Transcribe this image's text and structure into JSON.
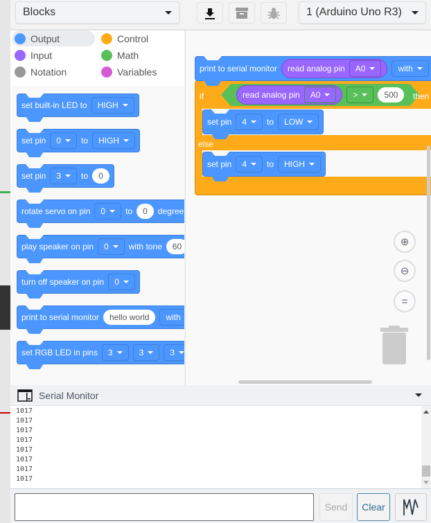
{
  "header": {
    "editor_mode": "Blocks",
    "device": "1 (Arduino Uno R3)",
    "toolbar": [
      {
        "icon": "download-icon"
      },
      {
        "icon": "library-icon"
      },
      {
        "icon": "debug-bug-icon"
      }
    ]
  },
  "categories": [
    {
      "label": "Output",
      "color": "#4c97ff",
      "selected": true
    },
    {
      "label": "Control",
      "color": "#ffab19"
    },
    {
      "label": "Input",
      "color": "#9966ff"
    },
    {
      "label": "Math",
      "color": "#59c059"
    },
    {
      "label": "Notation",
      "color": "#999999"
    },
    {
      "label": "Variables",
      "color": "#d65cd6"
    }
  ],
  "palette": {
    "b1": {
      "text": "set built-in LED to",
      "v": "HIGH"
    },
    "b2": {
      "text": "set pin",
      "pin": "0",
      "to": "to",
      "v": "HIGH"
    },
    "b3": {
      "text": "set pin",
      "pin": "3",
      "to": "to",
      "v": "0"
    },
    "b4": {
      "text": "rotate servo on pin",
      "pin": "0",
      "to": "to",
      "v": "0",
      "tail": "degrees"
    },
    "b5": {
      "text": "play speaker on pin",
      "pin": "0",
      "mid": "with tone",
      "v": "60"
    },
    "b6": {
      "text": "turn off speaker on pin",
      "pin": "0"
    },
    "b7": {
      "text": "print to serial monitor",
      "v": "hello world",
      "mid": "with"
    },
    "b8": {
      "text": "set RGB LED in pins",
      "p1": "3",
      "p2": "3",
      "p3": "3"
    }
  },
  "workspace": {
    "print": {
      "text": "print to serial monitor",
      "read": "read analog pin",
      "pin": "A0",
      "with": "with"
    },
    "if": {
      "if": "if",
      "read": "read analog pin",
      "pin": "A0",
      "op": ">",
      "value": "500",
      "then": "then",
      "else": "else"
    },
    "then_block": {
      "text": "set pin",
      "pin": "4",
      "to": "to",
      "v": "LOW"
    },
    "else_block": {
      "text": "set pin",
      "pin": "4",
      "to": "to",
      "v": "HIGH"
    }
  },
  "serial": {
    "title": "Serial Monitor",
    "lines": [
      "1017",
      "1017",
      "1017",
      "1017",
      "1017",
      "1017",
      "1017",
      "1017"
    ],
    "input_value": "",
    "send": "Send",
    "clear": "Clear"
  }
}
